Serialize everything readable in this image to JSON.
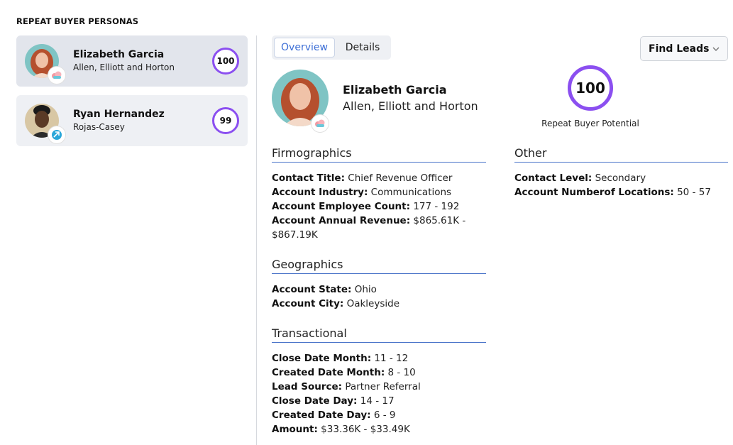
{
  "sidebar": {
    "title": "REPEAT BUYER PERSONAS",
    "personas": [
      {
        "name": "Elizabeth Garcia",
        "company": "Allen, Elliott and Horton",
        "score": "100"
      },
      {
        "name": "Ryan Hernandez",
        "company": "Rojas-Casey",
        "score": "99"
      }
    ]
  },
  "tabs": {
    "overview": "Overview",
    "details": "Details"
  },
  "find_leads": "Find Leads",
  "profile": {
    "name": "Elizabeth Garcia",
    "company": "Allen, Elliott and Horton",
    "score": "100",
    "score_label": "Repeat Buyer Potential"
  },
  "firmographics": {
    "title": "Firmographics",
    "rows": [
      {
        "label": "Contact Title:",
        "value": "Chief Revenue Officer"
      },
      {
        "label": "Account Industry:",
        "value": "Communications"
      },
      {
        "label": "Account Employee Count:",
        "value": "177 - 192"
      },
      {
        "label": "Account Annual Revenue:",
        "value": "$865.61K - $867.19K"
      }
    ]
  },
  "geographics": {
    "title": "Geographics",
    "rows": [
      {
        "label": "Account State:",
        "value": "Ohio"
      },
      {
        "label": "Account City:",
        "value": "Oakleyside"
      }
    ]
  },
  "transactional": {
    "title": "Transactional",
    "rows": [
      {
        "label": "Close Date Month:",
        "value": "11 - 12"
      },
      {
        "label": "Created Date Month:",
        "value": "8 - 10"
      },
      {
        "label": "Lead Source:",
        "value": "Partner Referral"
      },
      {
        "label": "Close Date Day:",
        "value": "14 - 17"
      },
      {
        "label": "Created Date Day:",
        "value": "6 - 9"
      },
      {
        "label": "Amount:",
        "value": "$33.36K - $33.49K"
      }
    ]
  },
  "other": {
    "title": "Other",
    "rows": [
      {
        "label": "Contact Level:",
        "value": "Secondary"
      },
      {
        "label": "Account Numberof Locations:",
        "value": "50 - 57"
      }
    ]
  },
  "colors": {
    "accent": "#8b4ff0",
    "link": "#3d6fd6",
    "card_bg": "#eef0f4"
  },
  "icons": {
    "crm_badge": "cloud-icon",
    "sync_badge": "sync-icon",
    "dropdown": "chevron-down-icon"
  }
}
